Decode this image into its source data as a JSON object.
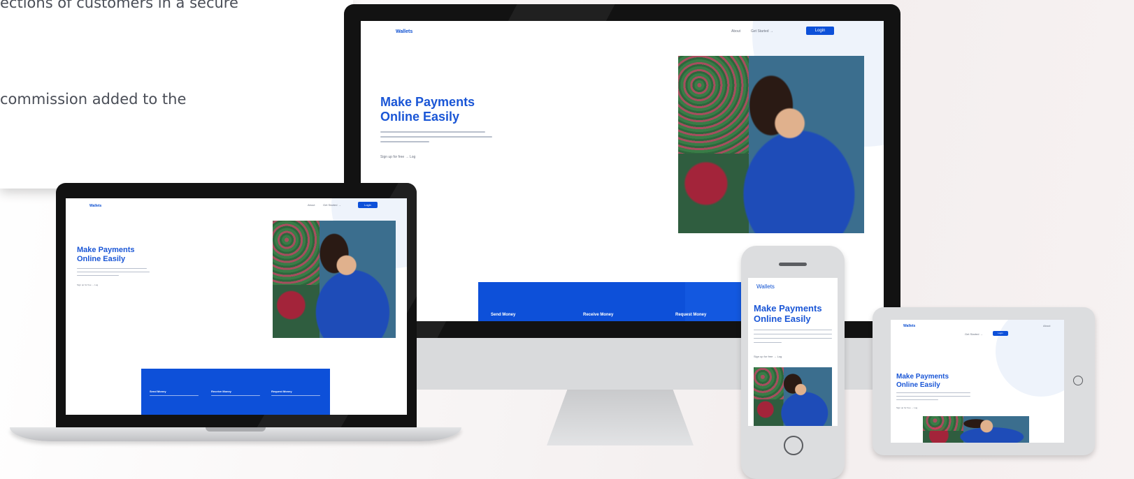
{
  "card": {
    "line1": "ections of customers in a  secure",
    "line2": "commission added to the"
  },
  "site": {
    "brand": "Wallets",
    "nav_about": "About",
    "nav_get_started": "Get Started →",
    "login_label": "Login",
    "hero_title_1": "Make Payments",
    "hero_title_2": "Online Easily",
    "cta_text": "Sign up for free → Log"
  },
  "features": [
    {
      "title": "Send Money"
    },
    {
      "title": "Receive Money"
    },
    {
      "title": "Request Money"
    }
  ],
  "colors": {
    "accent": "#0d50d9",
    "hero_text": "#1a56d6",
    "device_frame": "#111111",
    "device_silver": "#d7d8da"
  },
  "icons": {
    "tablet_home_button": "circle-outline-icon",
    "phone_home_button": "circle-outline-icon"
  }
}
